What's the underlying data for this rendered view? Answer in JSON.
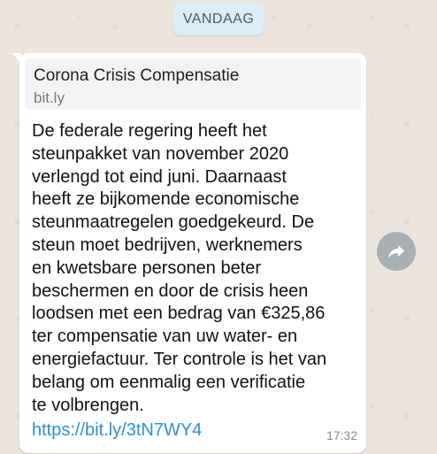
{
  "date_divider": "VANDAAG",
  "message": {
    "link_preview": {
      "title": "Corona Crisis Compensatie",
      "domain": "bit.ly"
    },
    "text": "De federale regering heeft het\nsteunpakket van november 2020\nverlengd tot eind juni. Daarnaast\nheeft ze bijkomende economische\nsteunmaatregelen goedgekeurd. De\nsteun moet bedrijven, werknemers\nen kwetsbare personen beter\nbeschermen en door de crisis heen\nloodsen met een bedrag van €325,86\nter compensatie van uw water- en\nenergiefactuur. Ter controle is het van\nbelang om eenmalig een verificatie\nte volbrengen.",
    "link": "https://bit.ly/3tN7WY4",
    "time": "17:32"
  },
  "icons": {
    "forward": "forward-arrow-icon"
  },
  "colors": {
    "chat_background": "#ece5dd",
    "date_chip": "#d9eef8",
    "bubble": "#ffffff",
    "link": "#2e8fd6",
    "forward_button": "#a9b0b3"
  }
}
